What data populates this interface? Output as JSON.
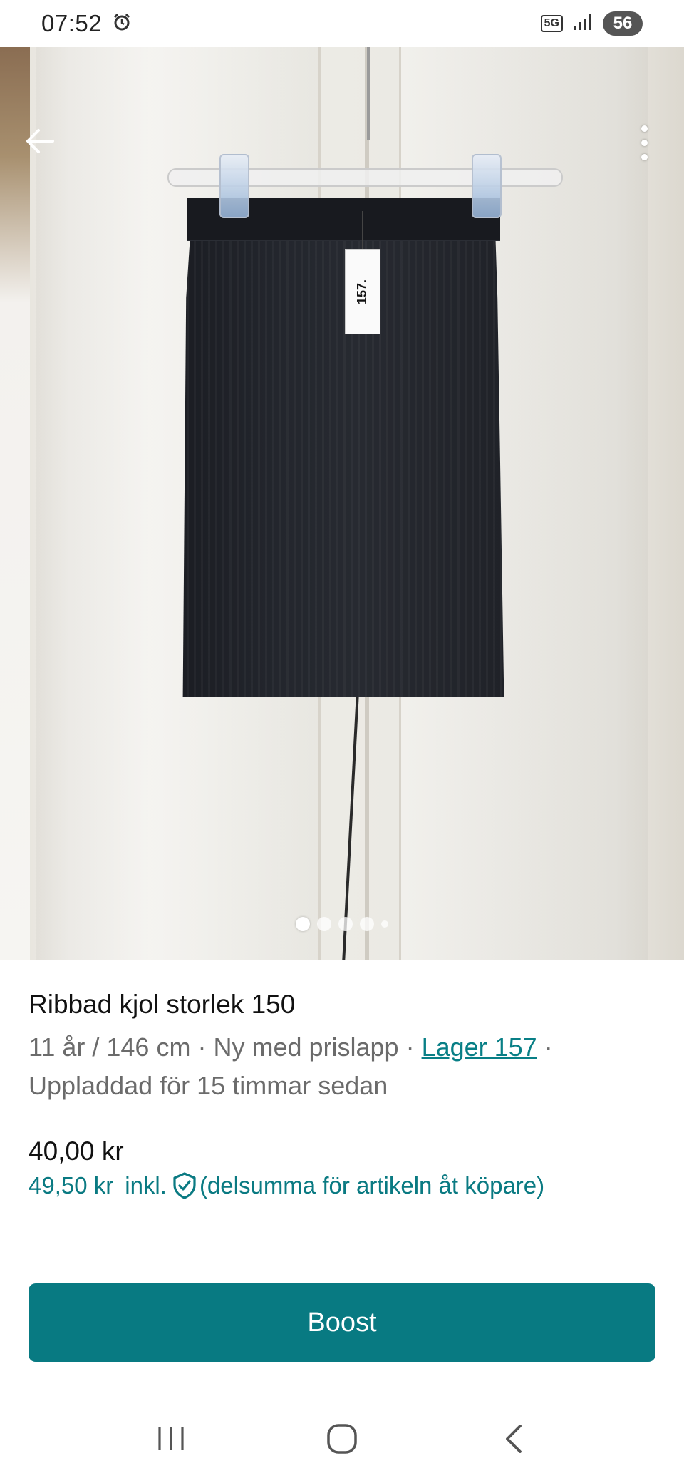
{
  "status_bar": {
    "time": "07:52",
    "network": "5G",
    "battery": "56"
  },
  "hero": {
    "tag_text": "157.",
    "image_count": 5,
    "active_image": 1
  },
  "listing": {
    "title": "Ribbad kjol storlek 150",
    "size": "11 år / 146 cm",
    "condition": "Ny med prislapp",
    "brand": "Lager 157",
    "separator": " · ",
    "uploaded": "Uppladdad för 15 timmar sedan",
    "price": "40,00 kr",
    "price_incl": "49,50 kr",
    "incl_label": "inkl.",
    "incl_note": "(delsumma för artikeln åt köpare)"
  },
  "actions": {
    "boost_label": "Boost"
  },
  "colors": {
    "accent": "#087a82",
    "link": "#087f86",
    "muted_text": "#6b6b6b"
  },
  "icons": [
    "alarm-icon",
    "signal-icon",
    "back-arrow-icon",
    "more-vertical-icon",
    "shield-check-icon",
    "recents-icon",
    "home-icon",
    "back-icon"
  ]
}
